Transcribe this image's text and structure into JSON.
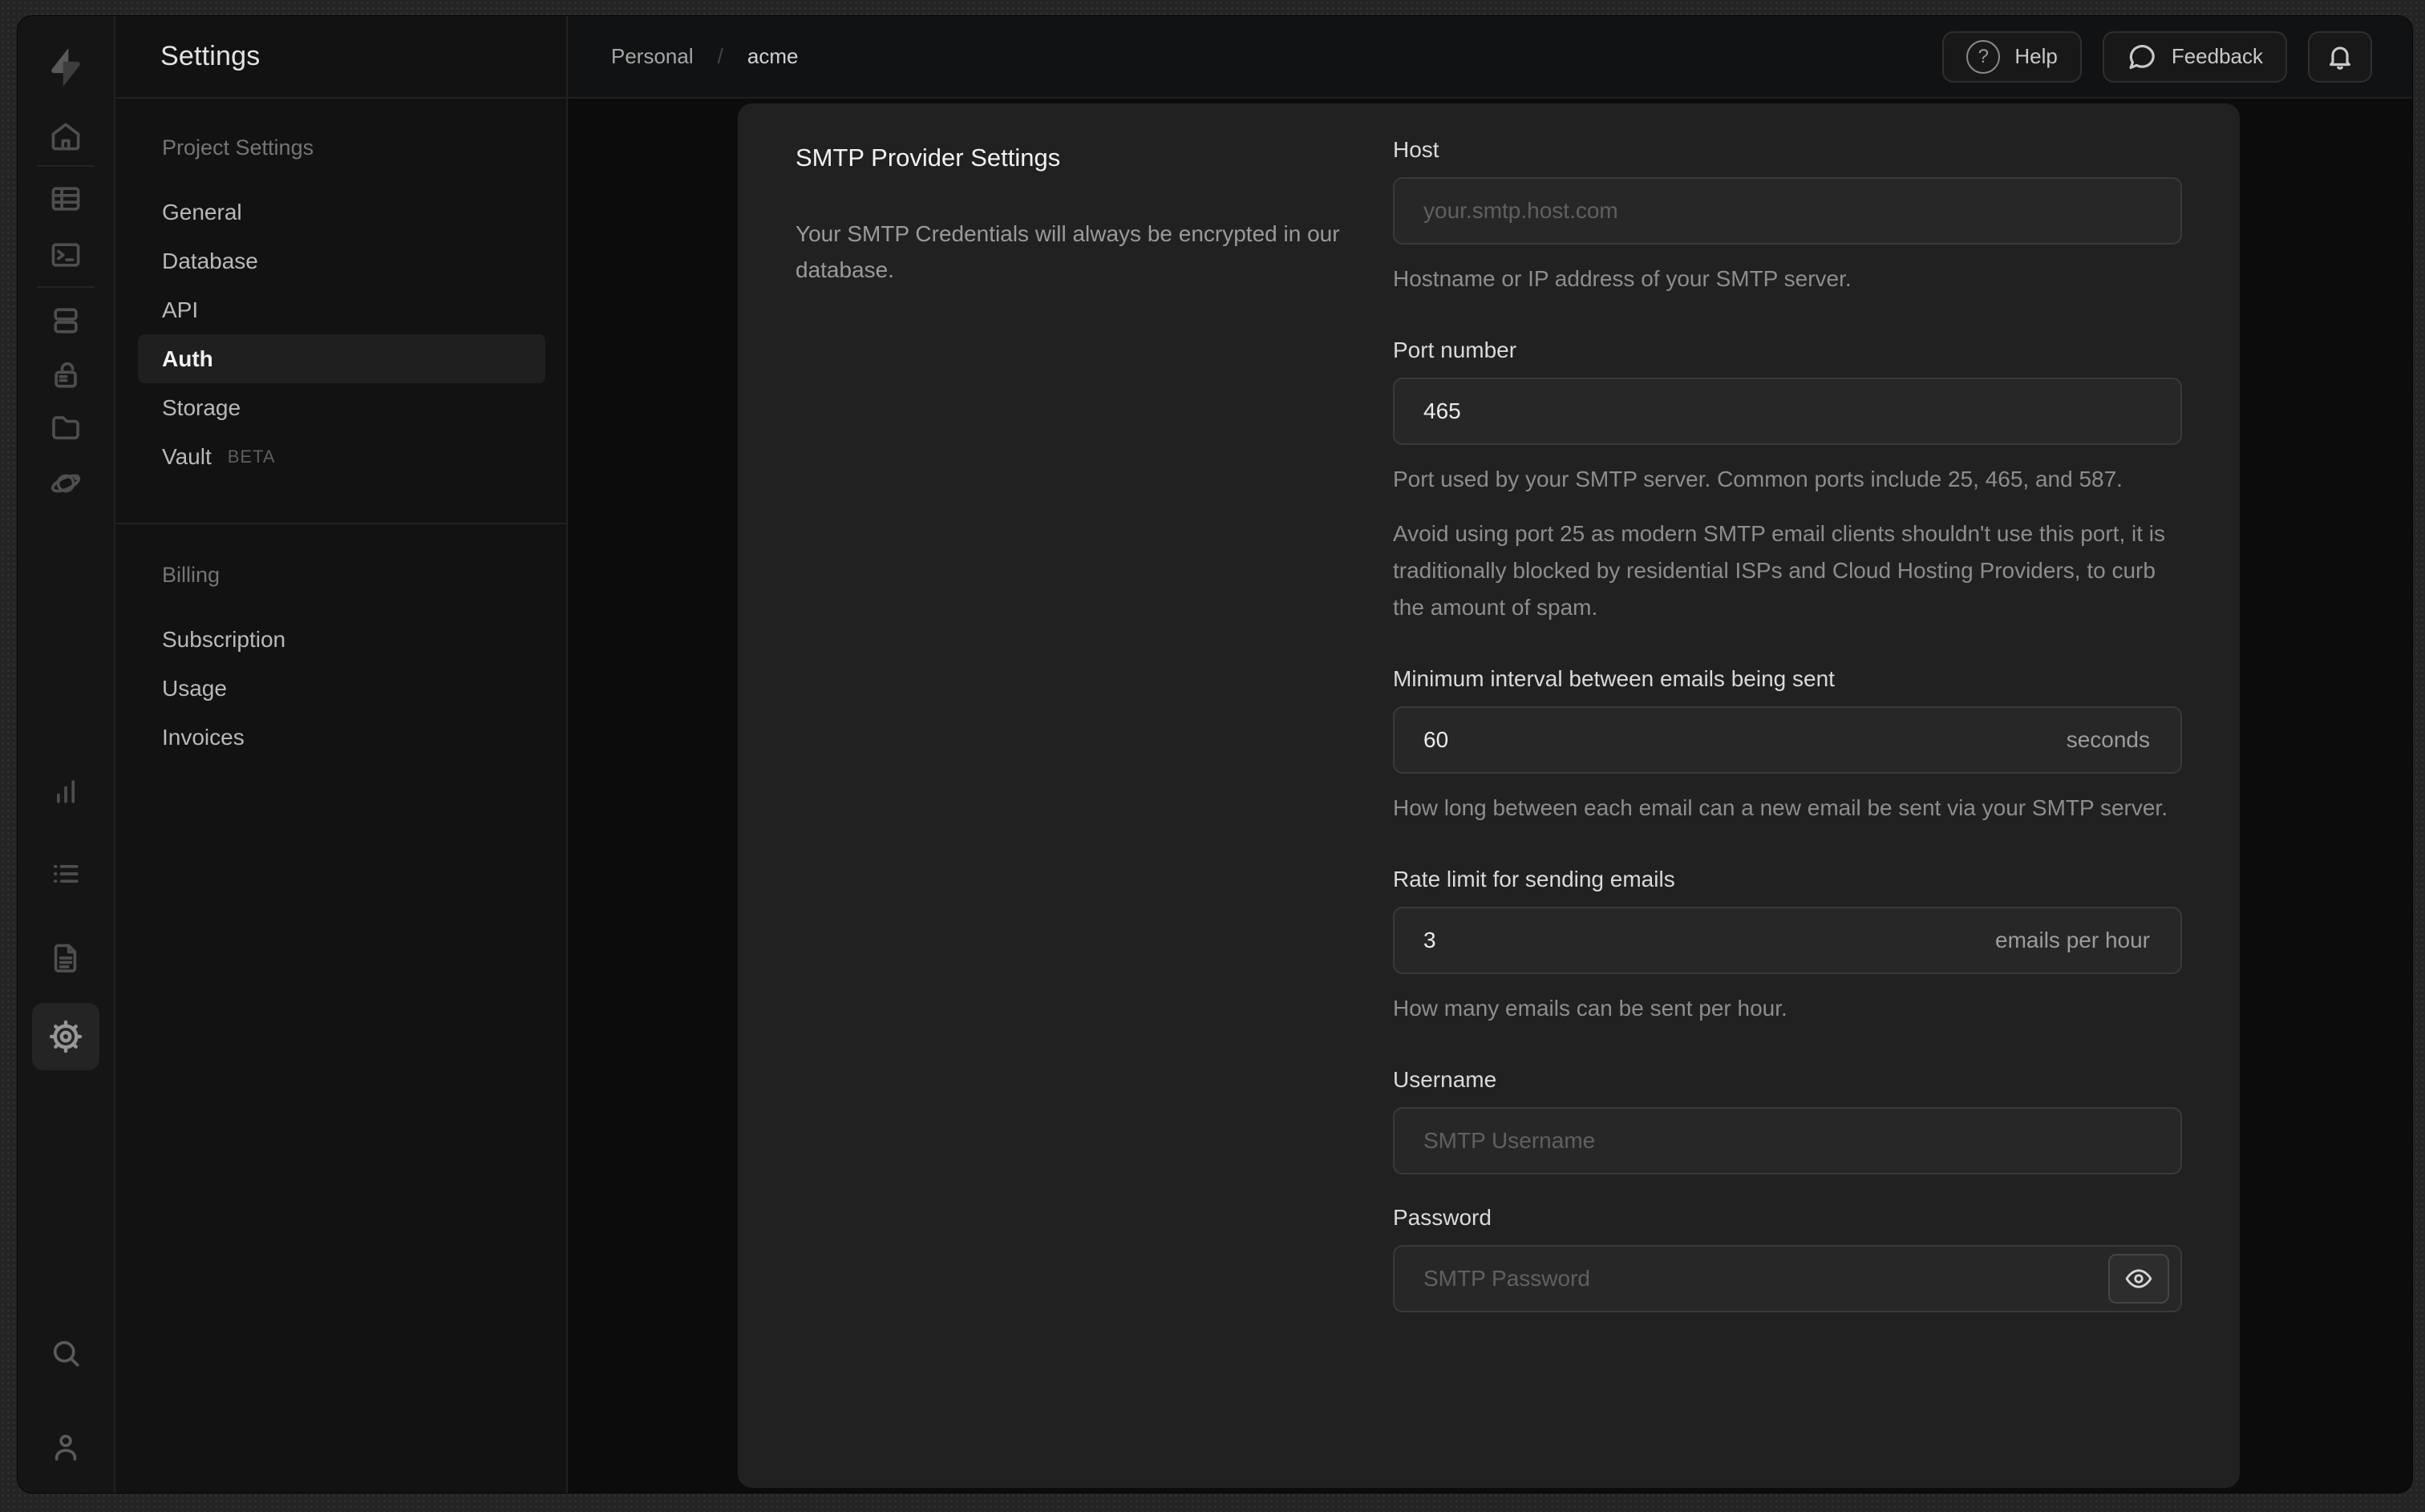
{
  "sidebar": {
    "title": "Settings",
    "sections": [
      {
        "header": "Project Settings",
        "items": [
          {
            "label": "General"
          },
          {
            "label": "Database"
          },
          {
            "label": "API"
          },
          {
            "label": "Auth"
          },
          {
            "label": "Storage"
          },
          {
            "label": "Vault",
            "badge": "BETA"
          }
        ]
      },
      {
        "header": "Billing",
        "items": [
          {
            "label": "Subscription"
          },
          {
            "label": "Usage"
          },
          {
            "label": "Invoices"
          }
        ]
      }
    ],
    "active_item": "Auth"
  },
  "rail": {
    "icons": [
      "home",
      "table-editor",
      "sql-editor",
      "database",
      "auth",
      "storage",
      "edge-functions",
      "reports",
      "logs",
      "docs",
      "settings"
    ],
    "bottom_icons": [
      "search",
      "account"
    ],
    "active_icon": "settings"
  },
  "header": {
    "breadcrumb": {
      "org": "Personal",
      "separator": "/",
      "project": "acme"
    },
    "help_label": "Help",
    "help_icon_glyph": "?",
    "feedback_label": "Feedback",
    "icons": [
      "help-circle",
      "feedback-bubble",
      "notifications-bell"
    ]
  },
  "smtp": {
    "title": "SMTP Provider Settings",
    "description": "Your SMTP Credentials will always be encrypted in our database.",
    "host": {
      "label": "Host",
      "placeholder": "your.smtp.host.com",
      "help": "Hostname or IP address of your SMTP server."
    },
    "port": {
      "label": "Port number",
      "value": "465",
      "help": "Port used by your SMTP server. Common ports include 25, 465, and 587.",
      "note": "Avoid using port 25 as modern SMTP email clients shouldn't use this port, it is traditionally blocked by residential ISPs and Cloud Hosting Providers, to curb the amount of spam."
    },
    "interval": {
      "label": "Minimum interval between emails being sent",
      "value": "60",
      "suffix": "seconds",
      "help": "How long between each email can a new email be sent via your SMTP server."
    },
    "rate": {
      "label": "Rate limit for sending emails",
      "value": "3",
      "suffix": "emails per hour",
      "help": "How many emails can be sent per hour."
    },
    "username": {
      "label": "Username",
      "placeholder": "SMTP Username"
    },
    "password": {
      "label": "Password",
      "placeholder": "SMTP Password"
    }
  },
  "colors": {
    "frame": "#242424",
    "app_bg": "#111213",
    "content_bg": "#0c0c0c",
    "card_bg": "#212121",
    "input_bg": "#272727",
    "input_border": "#3a3a3a",
    "text_primary": "#ededed",
    "text_secondary": "#8d8d8d"
  }
}
